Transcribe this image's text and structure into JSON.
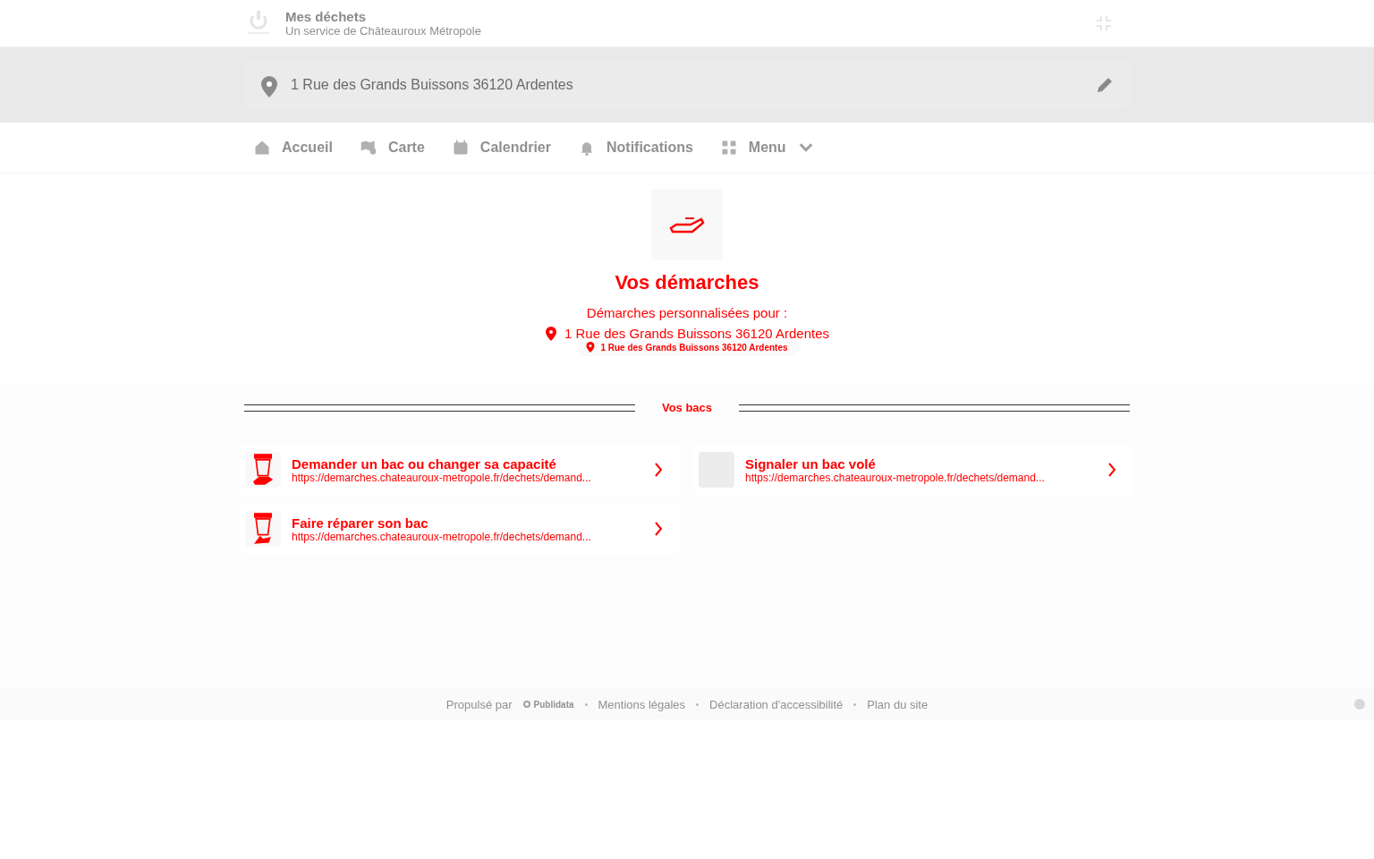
{
  "header": {
    "title": "Mes déchets",
    "subtitle": "Un service de Châteauroux Métropole"
  },
  "address_bar": {
    "address": "1 Rue des Grands Buissons 36120 Ardentes"
  },
  "nav": [
    {
      "label": "Accueil",
      "kind": "link"
    },
    {
      "label": "Carte",
      "kind": "link"
    },
    {
      "label": "Calendrier",
      "kind": "link"
    },
    {
      "label": "Notifications",
      "kind": "link"
    },
    {
      "label": "Menu",
      "kind": "dropdown"
    }
  ],
  "hero": {
    "title": "Vos démarches",
    "subtitle": "Démarches personnalisées pour :",
    "address": "1 Rue des Grands Buissons 36120 Ardentes",
    "address_chip": "1 Rue des Grands Buissons 36120 Ardentes"
  },
  "section": {
    "title": "Vos bacs"
  },
  "cards": [
    {
      "title": "Demander un bac ou changer sa capacité",
      "url": "https://demarches.chateauroux-metropole.fr/dechets/demand..."
    },
    {
      "title": "Signaler un bac volé",
      "url": "https://demarches.chateauroux-metropole.fr/dechets/demand..."
    },
    {
      "title": "Faire réparer son bac",
      "url": "https://demarches.chateauroux-metropole.fr/dechets/demand..."
    }
  ],
  "footer": {
    "powered_by": "Propulsé par",
    "brand": "Publidata",
    "links": [
      "Mentions légales",
      "Déclaration d'accessibilité",
      "Plan du site"
    ]
  }
}
